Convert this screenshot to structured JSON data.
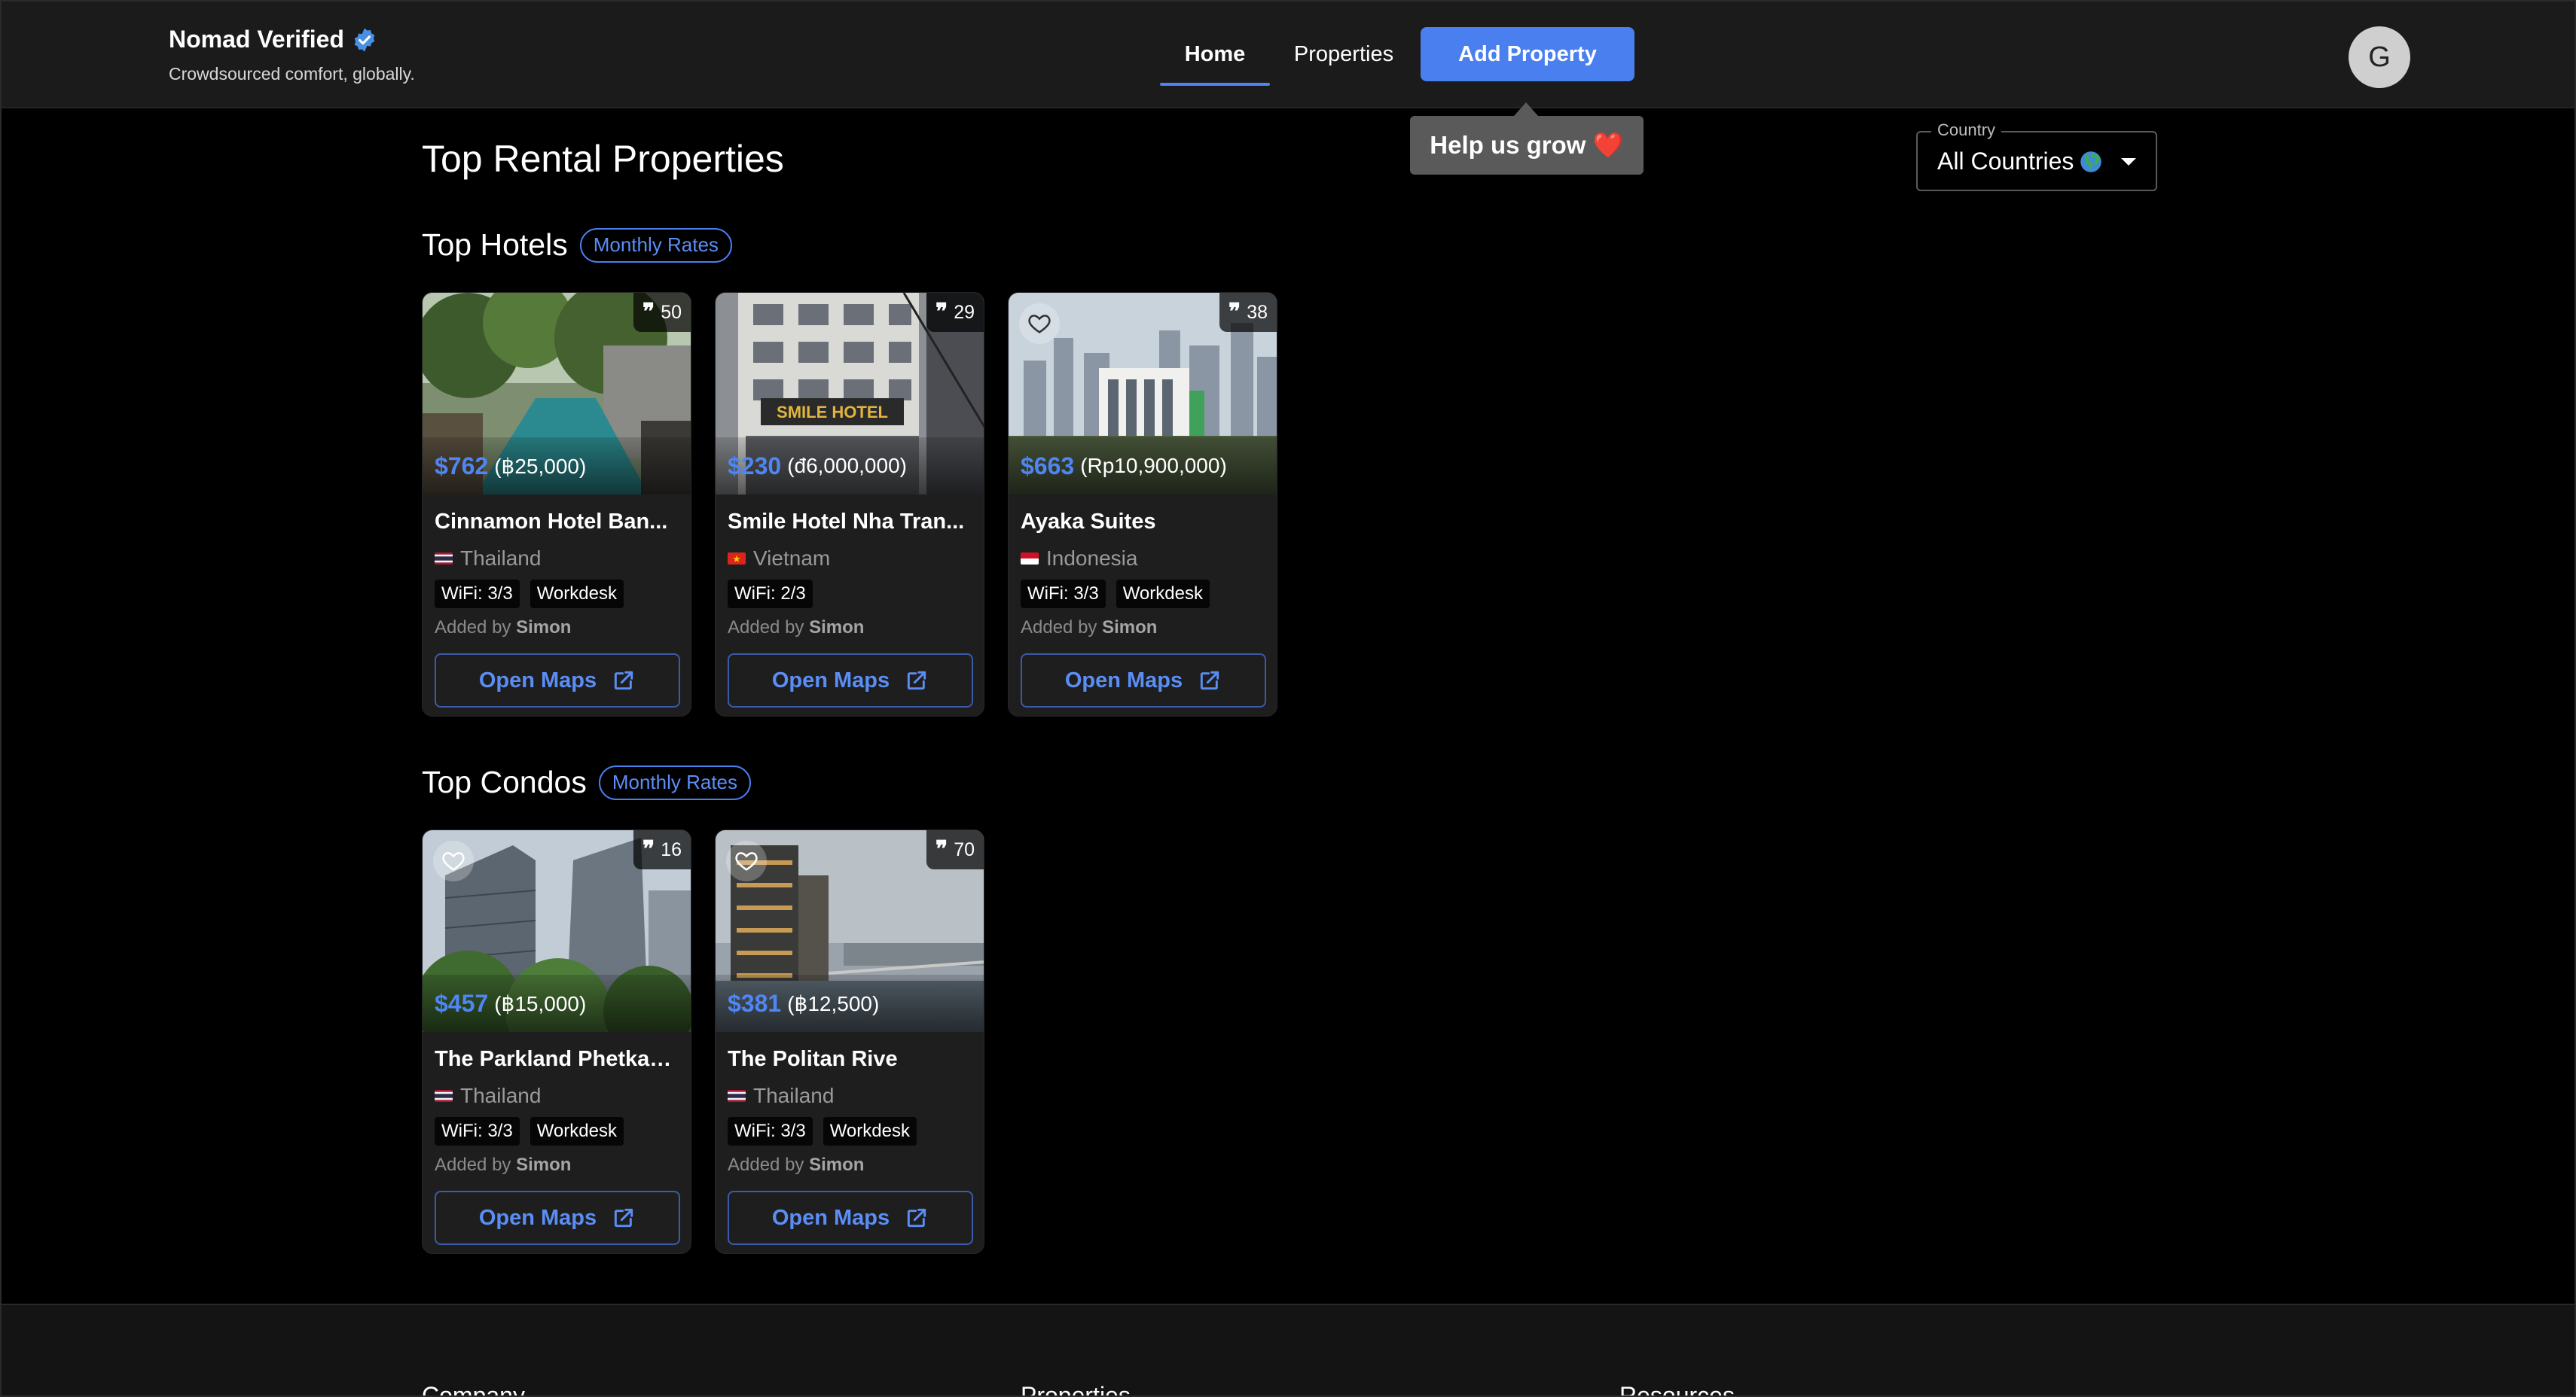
{
  "header": {
    "brand_title": "Nomad Verified",
    "brand_subtitle": "Crowdsourced comfort, globally.",
    "nav": {
      "home": "Home",
      "properties": "Properties"
    },
    "add_property": "Add Property",
    "tooltip": "Help us grow ❤️",
    "avatar_initial": "G"
  },
  "main": {
    "title": "Top Rental Properties",
    "country_filter": {
      "legend": "Country",
      "value": "All Countries"
    },
    "monthly_rates_label": "Monthly Rates",
    "open_maps_label": "Open Maps",
    "added_by_label": "Added by",
    "sections": {
      "hotels": {
        "title": "Top Hotels",
        "cards": [
          {
            "name": "Cinnamon Hotel Ban...",
            "country": "Thailand",
            "reviews": "50",
            "price_usd": "$762",
            "price_local": "(฿25,000)",
            "tags": [
              "WiFi: 3/3",
              "Workdesk"
            ],
            "added_by": "Simon"
          },
          {
            "name": "Smile Hotel Nha Tran...",
            "country": "Vietnam",
            "reviews": "29",
            "price_usd": "$230",
            "price_local": "(đ6,000,000)",
            "tags": [
              "WiFi: 2/3"
            ],
            "added_by": "Simon"
          },
          {
            "name": "Ayaka Suites",
            "country": "Indonesia",
            "reviews": "38",
            "price_usd": "$663",
            "price_local": "(Rp10,900,000)",
            "tags": [
              "WiFi: 3/3",
              "Workdesk"
            ],
            "added_by": "Simon"
          }
        ]
      },
      "condos": {
        "title": "Top Condos",
        "cards": [
          {
            "name": "The Parkland Phetkas...",
            "country": "Thailand",
            "reviews": "16",
            "price_usd": "$457",
            "price_local": "(฿15,000)",
            "tags": [
              "WiFi: 3/3",
              "Workdesk"
            ],
            "added_by": "Simon"
          },
          {
            "name": "The Politan Rive",
            "country": "Thailand",
            "reviews": "70",
            "price_usd": "$381",
            "price_local": "(฿12,500)",
            "tags": [
              "WiFi: 3/3",
              "Workdesk"
            ],
            "added_by": "Simon"
          }
        ]
      }
    }
  },
  "footer": {
    "columns": [
      "Company",
      "Properties",
      "Resources"
    ]
  },
  "colors": {
    "accent": "#4a7ff0",
    "price": "#4f86f4",
    "header_bg": "#1b1b1b",
    "card_bg": "#1e1e1e"
  }
}
